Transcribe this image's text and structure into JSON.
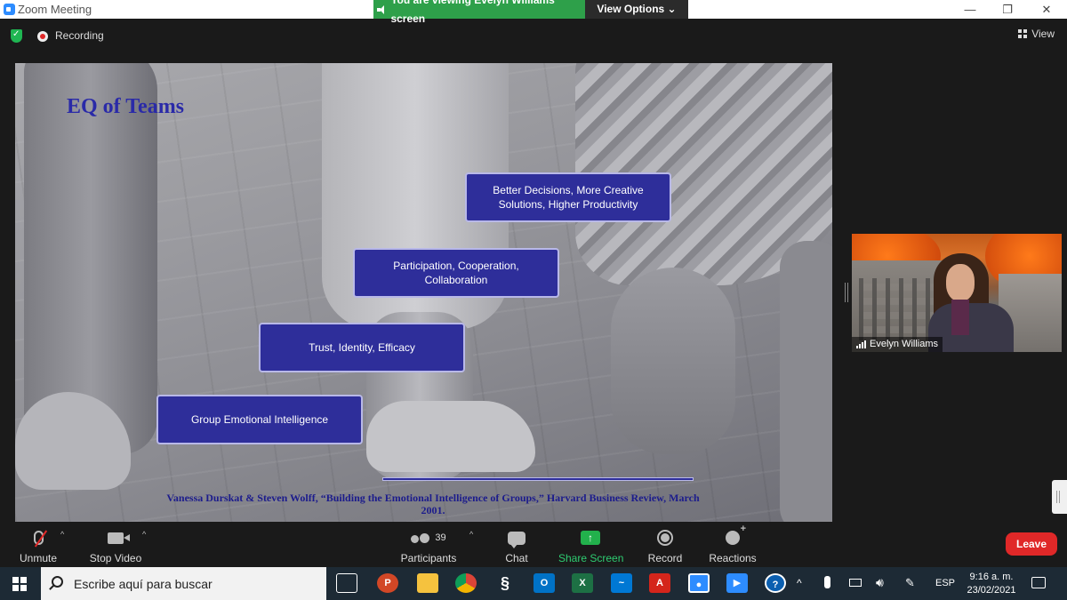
{
  "window": {
    "title": "Zoom Meeting",
    "share_banner": "You are viewing Evelyn Williams' screen",
    "view_options": "View Options ⌄",
    "minimize": "—",
    "restore": "❐",
    "close": "✕"
  },
  "topbar": {
    "recording_label": "Recording",
    "view_label": "View"
  },
  "slide": {
    "title": "EQ of Teams",
    "boxes": [
      "Group Emotional Intelligence",
      "Trust, Identity, Efficacy",
      "Participation, Cooperation, Collaboration",
      "Better Decisions, More Creative Solutions, Higher Productivity"
    ],
    "citation": "Vanessa Durskat & Steven Wolff, “Building the Emotional Intelligence of Groups,” Harvard Business Review, March 2001."
  },
  "video": {
    "participant_name": "Evelyn Williams"
  },
  "toolbar": {
    "unmute": "Unmute",
    "stop_video": "Stop Video",
    "participants": "Participants",
    "participant_count": "39",
    "chat": "Chat",
    "share_screen": "Share Screen",
    "record": "Record",
    "reactions": "Reactions",
    "leave": "Leave",
    "caret": "^"
  },
  "taskbar": {
    "search_placeholder": "Escribe aquí para buscar",
    "language": "ESP",
    "time": "9:16 a. m.",
    "date": "23/02/2021",
    "apps": [
      "task-view",
      "powerpoint",
      "file-explorer",
      "chrome",
      "gnome-terminal",
      "outlook",
      "excel",
      "mail",
      "acrobat",
      "zoom-meeting",
      "zoom",
      "help"
    ]
  },
  "colors": {
    "share_green": "#2ea04a",
    "slide_box": "#2e2e9a",
    "slide_title": "#2a2aa8",
    "leave_red": "#e02828",
    "share_icon_green": "#22b14c"
  }
}
